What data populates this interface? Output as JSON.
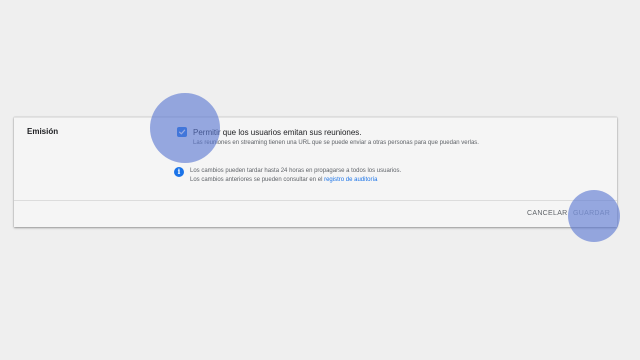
{
  "section": {
    "label": "Emisión"
  },
  "setting": {
    "checked": true,
    "title": "Permitir que los usuarios emitan sus reuniones.",
    "description": "Las reuniones en streaming tienen una URL que se puede enviar a otras personas para que puedan verlas."
  },
  "info": {
    "icon": "info-icon",
    "line1": "Los cambios pueden tardar hasta 24 horas en propagarse a todos los usuarios.",
    "line2_prefix": "Los cambios anteriores se pueden consultar en el ",
    "line2_link": "registro de auditoría"
  },
  "footer": {
    "cancel_label": "CANCELAR",
    "save_label": "GUARDAR"
  },
  "colors": {
    "accent": "#1a73e8",
    "touch_indicator": "#5a78d2"
  }
}
